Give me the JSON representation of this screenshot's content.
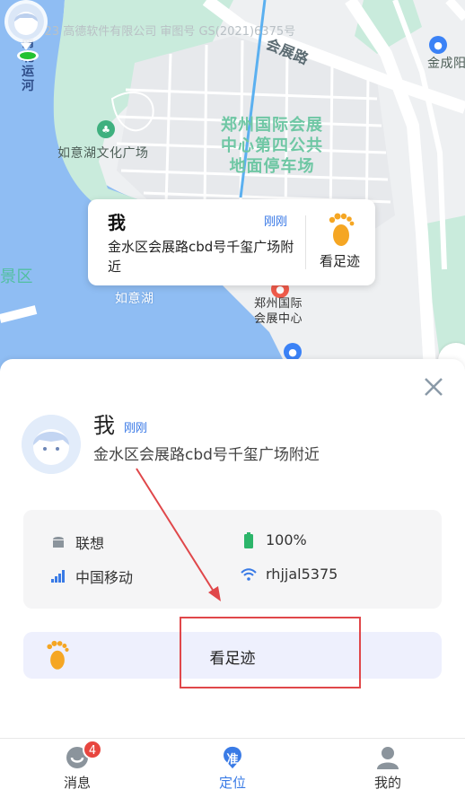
{
  "map": {
    "watermark": "©2023 高德软件有限公司 审图号 GS(2021)6375号",
    "labels": {
      "nanbei_canal": "南北运河",
      "huizhan_road": "会展路",
      "jincheng_road": "金成阳",
      "ruyi_lake_culture": "如意湖文化广场",
      "parking": "郑州国际会展中心第四公共地面停车场",
      "scenic": "景区",
      "ruyi_lake": "如意湖",
      "expo_center": "郑州国际会展中心"
    }
  },
  "bubble": {
    "name": "我",
    "time": "刚刚",
    "address": "金水区会展路cbd号千玺广场附近",
    "footprint_label": "看足迹"
  },
  "sheet": {
    "name": "我",
    "time": "刚刚",
    "address": "金水区会展路cbd号千玺广场附近",
    "device": {
      "model": "联想",
      "battery": "100%",
      "carrier": "中国移动",
      "wifi": "rhjjal5375"
    },
    "track_button": "看足迹"
  },
  "tabbar": {
    "tabs": [
      {
        "label": "消息",
        "badge": "4"
      },
      {
        "label": "定位",
        "icon_text": "准"
      },
      {
        "label": "我的"
      }
    ]
  },
  "colors": {
    "accent": "#3a7be6",
    "badge": "#e8463f",
    "annotation": "#e0474a",
    "footprint": "#f5a623"
  }
}
